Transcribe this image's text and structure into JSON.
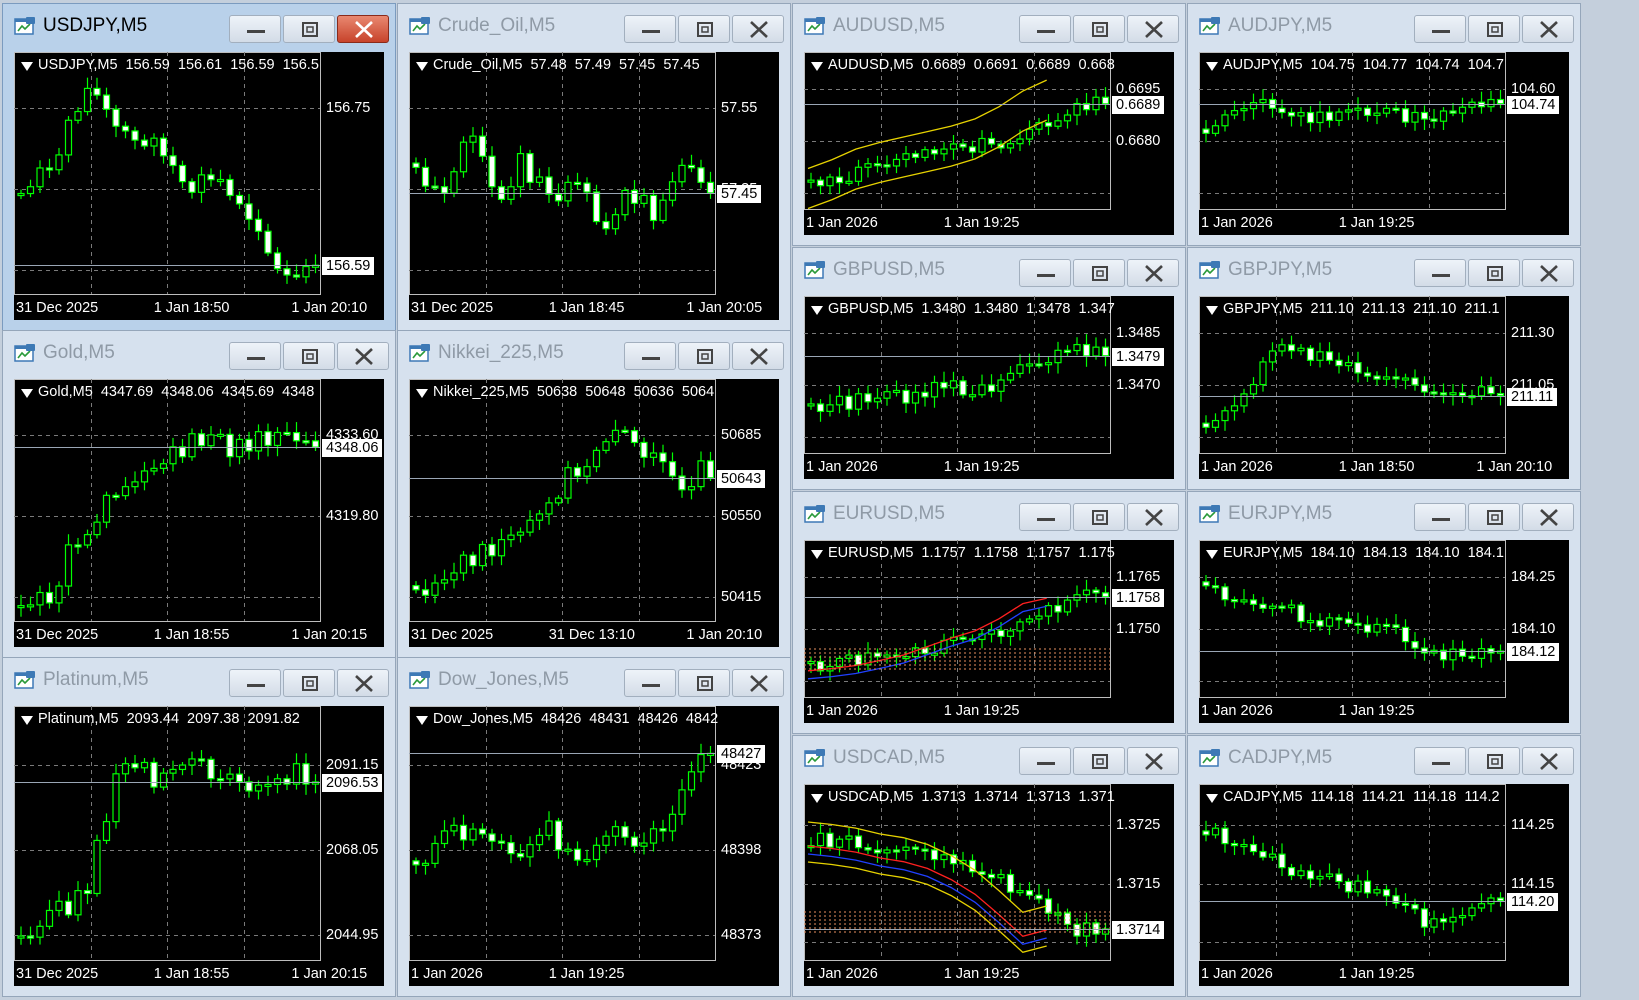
{
  "windows": [
    {
      "id": "usdjpy",
      "title": "USDJPY,M5",
      "info": {
        "symbol": "USDJPY,M5",
        "open": "156.59",
        "high": "156.61",
        "low": "156.59",
        "close": "156.5"
      },
      "price_ticks": [
        "156.75"
      ],
      "current_price": "156.59",
      "time_ticks": [
        "31 Dec 2025",
        "1 Jan 18:50",
        "1 Jan 20:10"
      ],
      "active": true,
      "trend": [
        0.45,
        0.55,
        0.8,
        0.95,
        0.78,
        0.7,
        0.62,
        0.5,
        0.55,
        0.35,
        0.15,
        0.05,
        0.15
      ],
      "overlay": "none"
    },
    {
      "id": "crude",
      "title": "Crude_Oil,M5",
      "info": {
        "symbol": "Crude_Oil,M5",
        "open": "57.48",
        "high": "57.49",
        "low": "57.45",
        "close": "57.45"
      },
      "price_ticks": [
        "57.55",
        "57.35"
      ],
      "current_price": "57.45",
      "time_ticks": [
        "31 Dec 2025",
        "1 Jan 18:45",
        "1 Jan 20:05"
      ],
      "active": false,
      "trend": [
        0.55,
        0.4,
        0.75,
        0.45,
        0.6,
        0.4,
        0.55,
        0.3,
        0.45,
        0.35,
        0.65,
        0.5
      ],
      "overlay": "none"
    },
    {
      "id": "audusd",
      "title": "AUDUSD,M5",
      "info": {
        "symbol": "AUDUSD,M5",
        "open": "0.6689",
        "high": "0.6691",
        "low": "0.6689",
        "close": "0.668"
      },
      "price_ticks": [
        "0.6695",
        "0.6680"
      ],
      "current_price": "0.6689",
      "time_ticks": [
        "1 Jan 2026",
        "1 Jan 19:25"
      ],
      "active": false,
      "trend": [
        0.12,
        0.2,
        0.3,
        0.35,
        0.4,
        0.45,
        0.5,
        0.6,
        0.75,
        0.85
      ],
      "overlay": "bands"
    },
    {
      "id": "audjpy",
      "title": "AUDJPY,M5",
      "info": {
        "symbol": "AUDJPY,M5",
        "open": "104.75",
        "high": "104.77",
        "low": "104.74",
        "close": "104.7"
      },
      "price_ticks": [
        "104.60"
      ],
      "current_price": "104.74",
      "time_ticks": [
        "1 Jan 2026",
        "1 Jan 19:25"
      ],
      "active": false,
      "trend": [
        0.6,
        0.75,
        0.8,
        0.7,
        0.72,
        0.75,
        0.7,
        0.72,
        0.8,
        0.85
      ],
      "overlay": "none"
    },
    {
      "id": "gold",
      "title": "Gold,M5",
      "info": {
        "symbol": "Gold,M5",
        "open": "4347.69",
        "high": "4348.06",
        "low": "4345.69",
        "close": "4348"
      },
      "price_ticks": [
        "4333.60",
        "4319.80"
      ],
      "current_price": "4348.06",
      "time_ticks": [
        "31 Dec 2025",
        "1 Jan 18:55",
        "1 Jan 20:15"
      ],
      "active": false,
      "trend": [
        0.05,
        0.1,
        0.4,
        0.55,
        0.65,
        0.75,
        0.85,
        0.8,
        0.85,
        0.9,
        0.85
      ],
      "overlay": "none"
    },
    {
      "id": "nikkei",
      "title": "Nikkei_225,M5",
      "info": {
        "symbol": "Nikkei_225,M5",
        "open": "50638",
        "high": "50648",
        "low": "50636",
        "close": "5064"
      },
      "price_ticks": [
        "50685",
        "50550",
        "50415"
      ],
      "current_price": "50643",
      "time_ticks": [
        "31 Dec 2025",
        "31 Dec 13:10",
        "1 Jan 20:10"
      ],
      "active": false,
      "trend": [
        0.1,
        0.15,
        0.25,
        0.35,
        0.45,
        0.55,
        0.7,
        0.8,
        0.9,
        0.7,
        0.65,
        0.7
      ],
      "overlay": "none"
    },
    {
      "id": "gbpusd",
      "title": "GBPUSD,M5",
      "info": {
        "symbol": "GBPUSD,M5",
        "open": "1.3480",
        "high": "1.3480",
        "low": "1.3478",
        "close": "1.347"
      },
      "price_ticks": [
        "1.3485",
        "1.3470"
      ],
      "current_price": "1.3479",
      "time_ticks": [
        "1 Jan 2026",
        "1 Jan 19:25"
      ],
      "active": false,
      "trend": [
        0.3,
        0.35,
        0.38,
        0.4,
        0.5,
        0.45,
        0.55,
        0.7,
        0.8,
        0.78
      ],
      "overlay": "none"
    },
    {
      "id": "gbpjpy",
      "title": "GBPJPY,M5",
      "info": {
        "symbol": "GBPJPY,M5",
        "open": "211.10",
        "high": "211.13",
        "low": "211.10",
        "close": "211.1"
      },
      "price_ticks": [
        "211.30",
        "211.05"
      ],
      "current_price": "211.11",
      "time_ticks": [
        "1 Jan 2026",
        "1 Jan 18:50",
        "1 Jan 20:10"
      ],
      "active": false,
      "trend": [
        0.2,
        0.35,
        0.8,
        0.75,
        0.7,
        0.6,
        0.55,
        0.45,
        0.4,
        0.45
      ],
      "overlay": "none"
    },
    {
      "id": "platinum",
      "title": "Platinum,M5",
      "info": {
        "symbol": "Platinum,M5",
        "open": "2093.44",
        "high": "2097.38",
        "low": "2091.82",
        "close": ""
      },
      "price_ticks": [
        "2091.15",
        "2068.05",
        "2044.95"
      ],
      "current_price": "2096.53",
      "time_ticks": [
        "31 Dec 2025",
        "1 Jan 18:55",
        "1 Jan 20:15"
      ],
      "active": false,
      "trend": [
        0.1,
        0.15,
        0.3,
        0.85,
        0.8,
        0.9,
        0.8,
        0.75,
        0.8,
        0.82
      ],
      "overlay": "none"
    },
    {
      "id": "dowjones",
      "title": "Dow_Jones,M5",
      "info": {
        "symbol": "Dow_Jones,M5",
        "open": "48426",
        "high": "48431",
        "low": "48426",
        "close": "4842"
      },
      "price_ticks": [
        "48423",
        "48398",
        "48373"
      ],
      "current_price": "48427",
      "time_ticks": [
        "1 Jan 2026",
        "1 Jan 19:25"
      ],
      "active": false,
      "trend": [
        0.4,
        0.6,
        0.5,
        0.45,
        0.55,
        0.45,
        0.6,
        0.5,
        0.65,
        0.95
      ],
      "overlay": "none"
    },
    {
      "id": "eurusd",
      "title": "EURUSD,M5",
      "info": {
        "symbol": "EURUSD,M5",
        "open": "1.1757",
        "high": "1.1758",
        "low": "1.1757",
        "close": "1.175"
      },
      "price_ticks": [
        "1.1765",
        "1.1750"
      ],
      "current_price": "1.1758",
      "time_ticks": [
        "1 Jan 2026",
        "1 Jan 19:25"
      ],
      "active": false,
      "trend": [
        0.2,
        0.22,
        0.25,
        0.3,
        0.35,
        0.45,
        0.5,
        0.6,
        0.75,
        0.8
      ],
      "overlay": "ichimoku"
    },
    {
      "id": "eurjpy",
      "title": "EURJPY,M5",
      "info": {
        "symbol": "EURJPY,M5",
        "open": "184.10",
        "high": "184.13",
        "low": "184.10",
        "close": "184.1"
      },
      "price_ticks": [
        "184.25",
        "184.10"
      ],
      "current_price": "184.12",
      "time_ticks": [
        "1 Jan 2026",
        "1 Jan 19:25"
      ],
      "active": false,
      "trend": [
        0.8,
        0.75,
        0.7,
        0.6,
        0.55,
        0.5,
        0.45,
        0.3,
        0.25,
        0.35
      ],
      "overlay": "none"
    },
    {
      "id": "usdcad",
      "title": "USDCAD,M5",
      "info": {
        "symbol": "USDCAD,M5",
        "open": "1.3713",
        "high": "1.3714",
        "low": "1.3713",
        "close": "1.371"
      },
      "price_ticks": [
        "1.3725",
        "1.3715"
      ],
      "current_price": "1.3714",
      "time_ticks": [
        "1 Jan 2026",
        "1 Jan 19:25"
      ],
      "active": false,
      "trend": [
        0.8,
        0.78,
        0.75,
        0.7,
        0.68,
        0.6,
        0.5,
        0.35,
        0.15,
        0.2
      ],
      "overlay": "ichimoku-bands"
    },
    {
      "id": "cadjpy",
      "title": "CADJPY,M5",
      "info": {
        "symbol": "CADJPY,M5",
        "open": "114.18",
        "high": "114.21",
        "low": "114.18",
        "close": "114.2"
      },
      "price_ticks": [
        "114.25",
        "114.15"
      ],
      "current_price": "114.20",
      "time_ticks": [
        "1 Jan 2026",
        "1 Jan 19:25"
      ],
      "active": false,
      "trend": [
        0.85,
        0.8,
        0.65,
        0.55,
        0.5,
        0.45,
        0.3,
        0.2,
        0.25,
        0.4
      ],
      "overlay": "none"
    }
  ],
  "colors": {
    "up": "#ffffff",
    "down": "#00ff00",
    "grid": "#7a7a7a",
    "bull_wick": "#00ff00"
  }
}
